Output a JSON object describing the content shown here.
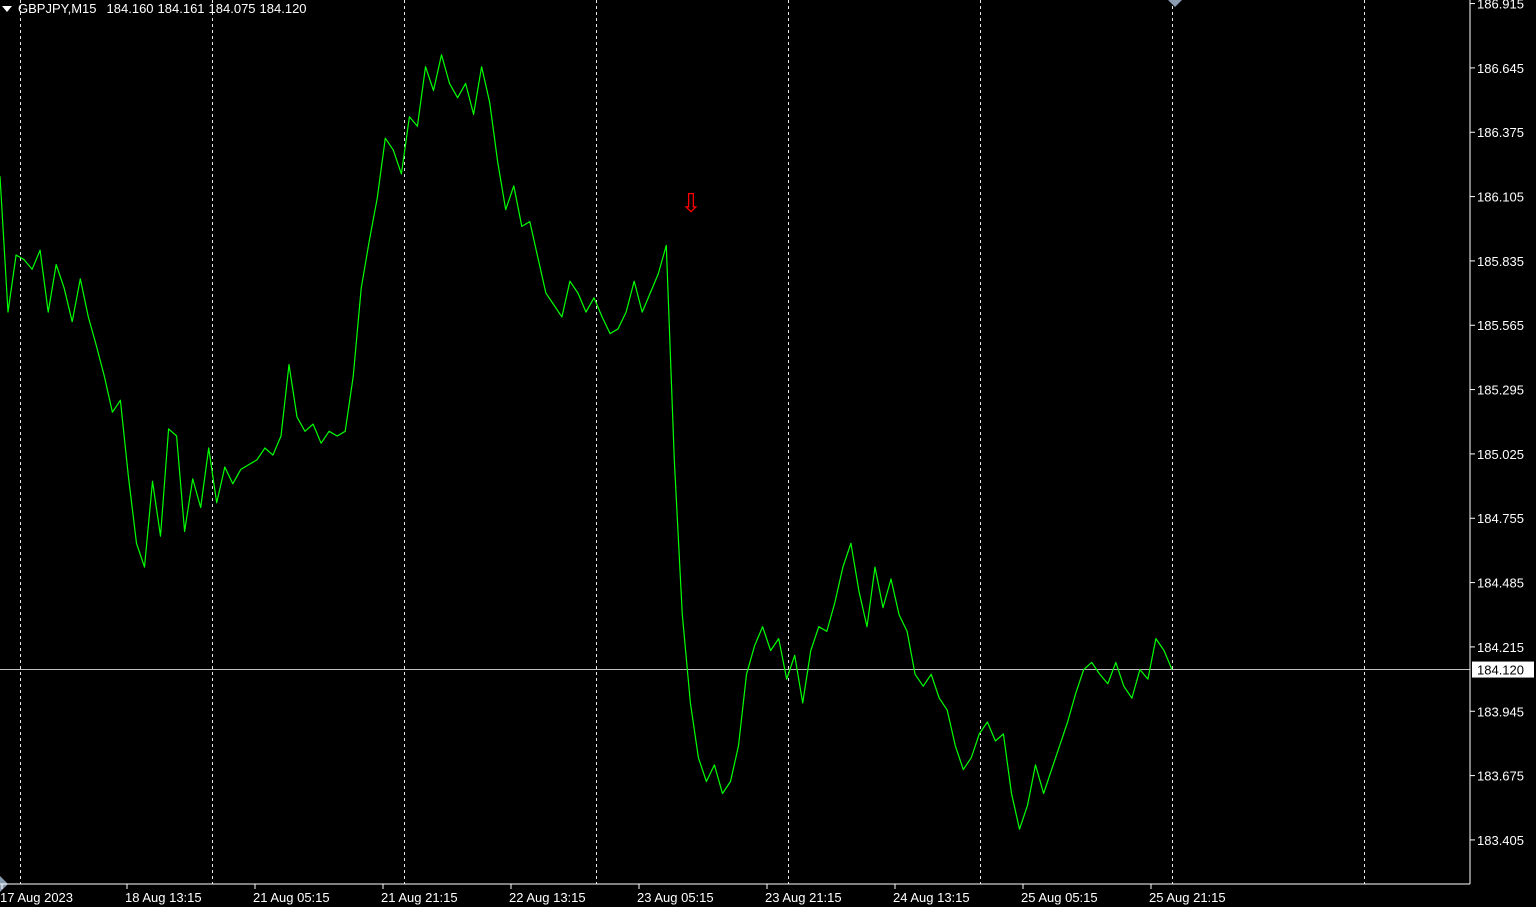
{
  "header": {
    "symbol": "GBPJPY,M15",
    "open": "184.160",
    "high": "184.161",
    "low": "184.075",
    "close": "184.120"
  },
  "colors": {
    "background": "#000000",
    "line": "#00ff00",
    "grid": "#ffffff",
    "axis_text": "#ffffff",
    "current_price_line": "#c0c0c0",
    "sell_arrow": "#ff0000",
    "price_label_bg": "#ffffff",
    "price_label_text": "#000000"
  },
  "chart_data": {
    "type": "line",
    "symbol": "GBPJPY",
    "timeframe": "M15",
    "y_ticks": [
      "186.915",
      "186.645",
      "186.375",
      "186.105",
      "185.835",
      "185.565",
      "185.295",
      "185.025",
      "184.755",
      "184.485",
      "184.215",
      "183.945",
      "183.675",
      "183.405"
    ],
    "ylim": [
      183.22,
      186.93
    ],
    "x_ticks": [
      "17 Aug 2023",
      "18 Aug 13:15",
      "21 Aug 05:15",
      "21 Aug 21:15",
      "22 Aug 13:15",
      "23 Aug 05:15",
      "23 Aug 21:15",
      "24 Aug 13:15",
      "25 Aug 05:15",
      "25 Aug 21:15"
    ],
    "current_price": "184.120",
    "series": [
      {
        "values": [
          186.19,
          185.62,
          185.86,
          185.84,
          185.8,
          185.88,
          185.62,
          185.82,
          185.72,
          185.58,
          185.76,
          185.6,
          185.48,
          185.35,
          185.2,
          185.25,
          184.93,
          184.65,
          184.55,
          184.91,
          184.68,
          185.13,
          185.1,
          184.7,
          184.92,
          184.8,
          185.05,
          184.82,
          184.97,
          184.9,
          184.96,
          184.98,
          185.0,
          185.05,
          185.02,
          185.1,
          185.4,
          185.18,
          185.12,
          185.15,
          185.07,
          185.12,
          185.1,
          185.12,
          185.35,
          185.72,
          185.92,
          186.1,
          186.35,
          186.3,
          186.2,
          186.44,
          186.4,
          186.65,
          186.55,
          186.7,
          186.58,
          186.52,
          186.58,
          186.45,
          186.65,
          186.5,
          186.25,
          186.05,
          186.15,
          185.98,
          186.0,
          185.85,
          185.7,
          185.65,
          185.6,
          185.75,
          185.7,
          185.62,
          185.68,
          185.6,
          185.53,
          185.55,
          185.62,
          185.75,
          185.62,
          185.7,
          185.78,
          185.9,
          185.0,
          184.35,
          183.98,
          183.75,
          183.65,
          183.72,
          183.6,
          183.65,
          183.8,
          184.1,
          184.22,
          184.3,
          184.2,
          184.25,
          184.08,
          184.18,
          183.98,
          184.2,
          184.3,
          184.28,
          184.4,
          184.55,
          184.65,
          184.45,
          184.3,
          184.55,
          184.38,
          184.5,
          184.35,
          184.28,
          184.1,
          184.05,
          184.1,
          184.0,
          183.95,
          183.8,
          183.7,
          183.75,
          183.85,
          183.9,
          183.82,
          183.85,
          183.6,
          183.45,
          183.55,
          183.72,
          183.6,
          183.7,
          183.8,
          183.9,
          184.02,
          184.12,
          184.15,
          184.1,
          184.06,
          184.15,
          184.05,
          184.0,
          184.12,
          184.08,
          184.25,
          184.2,
          184.12
        ]
      }
    ],
    "annotations": [
      {
        "type": "sell-arrow",
        "symbol": "⇩"
      }
    ],
    "grid": "vertical-dashed",
    "price_scale": "right"
  }
}
